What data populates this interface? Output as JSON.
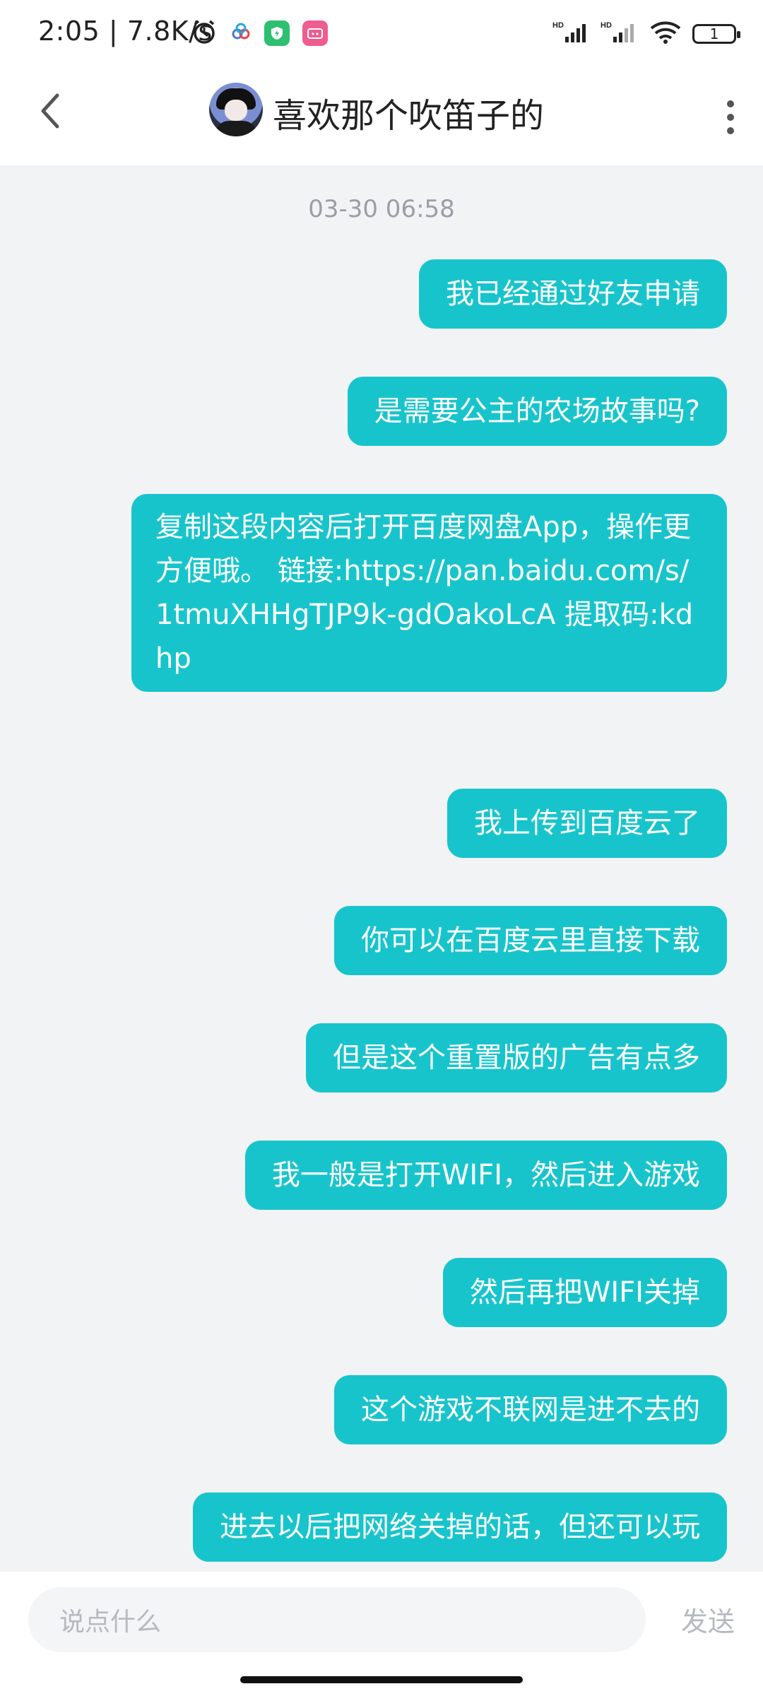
{
  "status_bar": {
    "time": "2:05",
    "net_speed": "7.8K/s",
    "battery": "1",
    "icons": [
      "alarm-icon",
      "cloud-app-icon",
      "shield-app-icon",
      "bilibili-app-icon",
      "hd-signal-icon",
      "hd-signal-icon",
      "wifi-icon",
      "battery-icon"
    ]
  },
  "header": {
    "title": "喜欢那个吹笛子的",
    "back_icon": "chevron-left-icon",
    "more_icon": "more-vertical-icon"
  },
  "chat": {
    "timestamp": "03-30 06:58",
    "messages": [
      "我已经通过好友申请",
      "是需要公主的农场故事吗?",
      "复制这段内容后打开百度网盘App，操作更方便哦。 链接:https://pan.baidu.com/s/1tmuXHHgTJP9k-gdOakoLcA 提取码:kdhp",
      "我上传到百度云了",
      "你可以在百度云里直接下载",
      "但是这个重置版的广告有点多",
      "我一般是打开WIFI，然后进入游戏",
      "然后再把WIFI关掉",
      "这个游戏不联网是进不去的",
      "进去以后把网络关掉的话，但还可以玩"
    ]
  },
  "input_bar": {
    "placeholder": "说点什么",
    "send_label": "发送"
  },
  "colors": {
    "bubble": "#18c4cc",
    "background": "#f2f3f5"
  }
}
